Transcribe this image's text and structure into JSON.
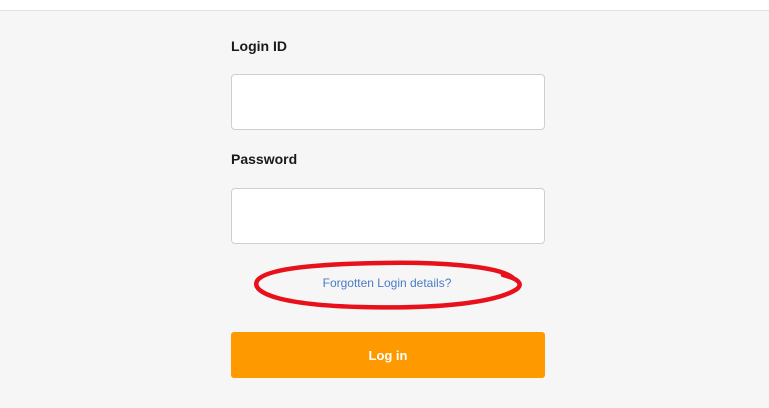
{
  "form": {
    "login_id_label": "Login ID",
    "login_id_value": "",
    "password_label": "Password",
    "password_value": "",
    "forgot_link": "Forgotten Login details?",
    "login_button": "Log in"
  },
  "colors": {
    "accent": "#ff9900",
    "link": "#4a7cc4",
    "annotation": "#e8101a",
    "panel_bg": "#f6f6f6"
  }
}
